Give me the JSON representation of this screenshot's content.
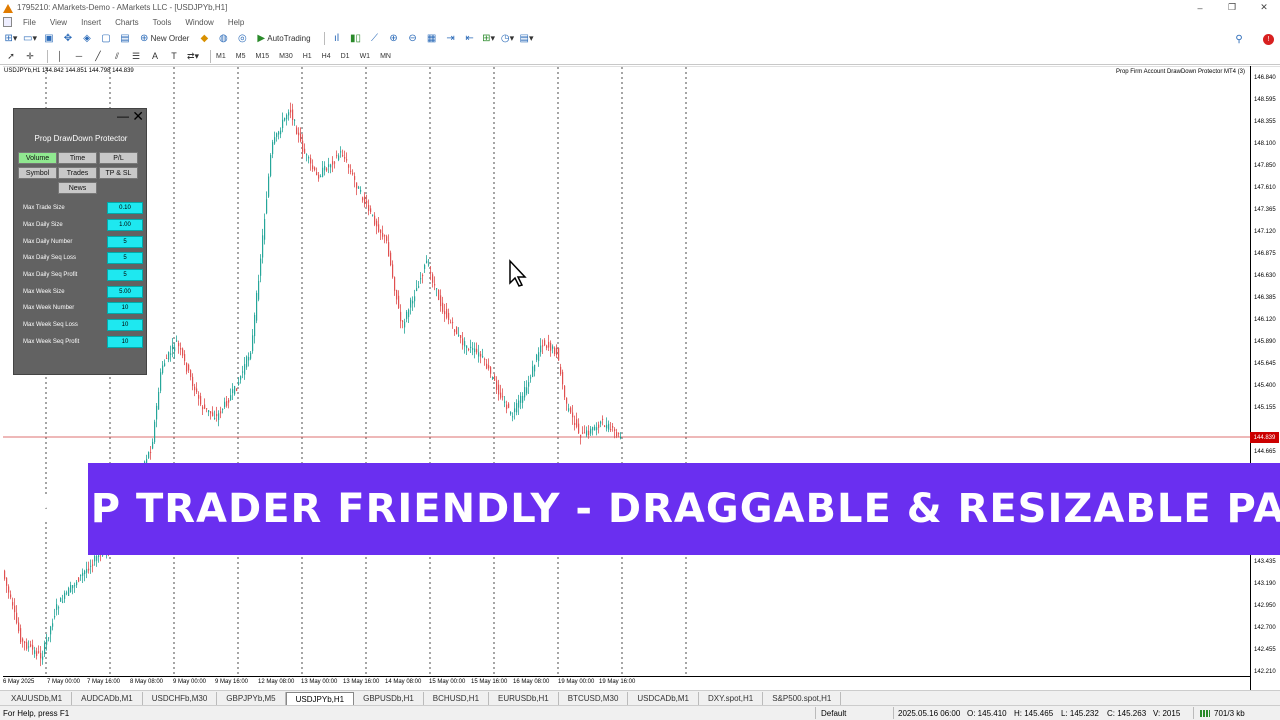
{
  "window": {
    "title": "1795210: AMarkets-Demo - AMarkets LLC - [USDJPYb,H1]",
    "controls": [
      "–",
      "❐",
      "✕"
    ]
  },
  "menu": [
    "File",
    "View",
    "Insert",
    "Charts",
    "Tools",
    "Window",
    "Help"
  ],
  "toolbar": {
    "new_order": "New Order",
    "autotrading": "AutoTrading",
    "timeframes": [
      "M1",
      "M5",
      "M15",
      "M30",
      "H1",
      "H4",
      "D1",
      "W1",
      "MN"
    ]
  },
  "chart": {
    "symbol_info": "USDJPYb,H1  144.842 144.851 144.798 144.839",
    "indicator_label": "Prop Firm Account DrawDown Protector MT4 (3)",
    "current_price": "144.839",
    "price_ticks": [
      "146.840",
      "148.595",
      "148.355",
      "148.100",
      "147.850",
      "147.610",
      "147.365",
      "147.120",
      "146.875",
      "146.630",
      "146.385",
      "146.120",
      "145.890",
      "145.645",
      "145.400",
      "145.155",
      "144.665",
      "143.435",
      "143.190",
      "142.950",
      "142.700",
      "142.455",
      "142.210"
    ],
    "time_ticks": [
      "6 May 2025",
      "7 May 00:00",
      "7 May 16:00",
      "8 May 08:00",
      "9 May 00:00",
      "9 May 16:00",
      "12 May 08:00",
      "13 May 00:00",
      "13 May 16:00",
      "14 May 08:00",
      "15 May 00:00",
      "15 May 16:00",
      "16 May 08:00",
      "19 May 00:00",
      "19 May 16:00"
    ]
  },
  "panel": {
    "title": "Prop DrawDown Protector",
    "minimize": "—",
    "close": "✕",
    "buttons": [
      "Volume",
      "Time",
      "P/L",
      "Symbol",
      "Trades",
      "TP & SL",
      "News"
    ],
    "rows": [
      {
        "label": "Max Trade Size",
        "value": "0.10"
      },
      {
        "label": "Max Daily Size",
        "value": "1.00"
      },
      {
        "label": "Max Daily Number",
        "value": "5"
      },
      {
        "label": "Max Daily Seq Loss",
        "value": "5"
      },
      {
        "label": "Max Daily Seq Profit",
        "value": "5"
      },
      {
        "label": "Max Week Size",
        "value": "5.00"
      },
      {
        "label": "Max Week Number",
        "value": "10"
      },
      {
        "label": "Max Week Seq Loss",
        "value": "10"
      },
      {
        "label": "Max Week Seq Profit",
        "value": "10"
      }
    ]
  },
  "banner": {
    "text": "PROP TRADER FRIENDLY - DRAGGABLE & RESIZABLE PANEL"
  },
  "tabs": [
    "XAUUSDb,M1",
    "AUDCADb,M1",
    "USDCHFb,M30",
    "GBPJPYb,M5",
    "USDJPYb,H1",
    "GBPUSDb,H1",
    "BCHUSD,H1",
    "EURUSDb,H1",
    "BTCUSD,M30",
    "USDCADb,M1",
    "DXY.spot,H1",
    "S&P500.spot,H1"
  ],
  "active_tab": "USDJPYb,H1",
  "status": {
    "help": "For Help, press F1",
    "profile": "Default",
    "datetime": "2025.05.16 06:00",
    "open": "O: 145.410",
    "high": "H: 145.465",
    "low": "L: 145.232",
    "close": "C: 145.263",
    "volume": "V: 2015",
    "traffic": "701/3 kb"
  },
  "colors": {
    "bull": "#26a69a",
    "bear": "#e05050",
    "banner": "#6a2ff0",
    "panel_bg": "#626262",
    "field": "#1ee8f0",
    "active_btn": "#90e890"
  }
}
